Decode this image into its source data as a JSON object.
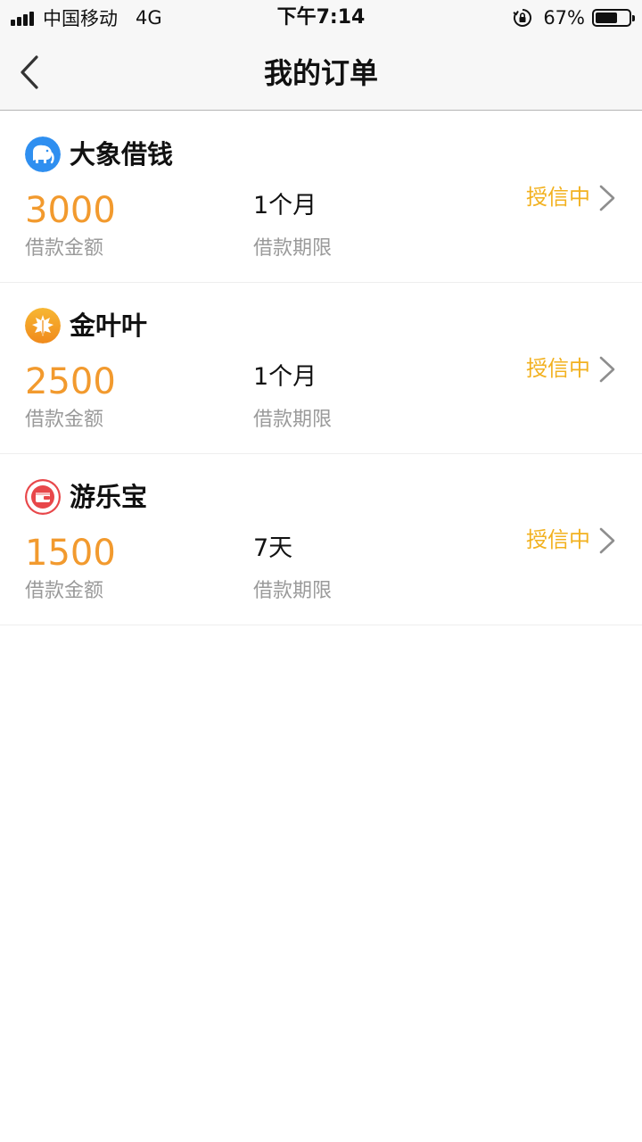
{
  "status_bar": {
    "carrier": "中国移动",
    "network": "4G",
    "time": "下午7:14",
    "battery_percent": "67%",
    "battery_level": 0.67,
    "icons": [
      "signal-icon",
      "rotation-lock-icon",
      "battery-icon"
    ]
  },
  "nav": {
    "title": "我的订单",
    "back_icon": "chevron-left-icon"
  },
  "colors": {
    "amount": "#f29a2e",
    "status": "#f2b11f",
    "label_gray": "#9a9a9a",
    "bar_bg": "#f7f7f7"
  },
  "orders": [
    {
      "lender": "大象借钱",
      "logo_icon": "elephant-icon",
      "logo_color": "#2f8ff0",
      "amount": "3000",
      "amount_label": "借款金额",
      "term": "1个月",
      "term_label": "借款期限",
      "status": "授信中"
    },
    {
      "lender": "金叶叶",
      "logo_icon": "leaf-icon",
      "logo_color": "#f5a623",
      "amount": "2500",
      "amount_label": "借款金额",
      "term": "1个月",
      "term_label": "借款期限",
      "status": "授信中"
    },
    {
      "lender": "游乐宝",
      "logo_icon": "wallet-icon",
      "logo_color": "#e8474a",
      "amount": "1500",
      "amount_label": "借款金额",
      "term": "7天",
      "term_label": "借款期限",
      "status": "授信中"
    }
  ]
}
